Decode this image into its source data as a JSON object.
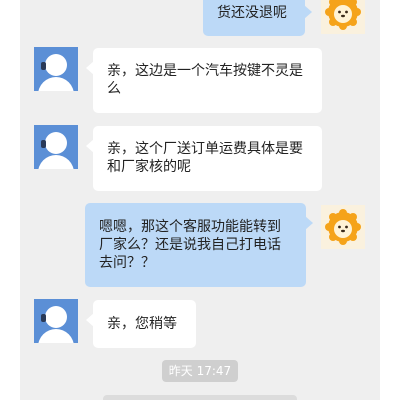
{
  "conversation": {
    "messages": [
      {
        "from": "user",
        "text": "货还没退呢"
      },
      {
        "from": "agent",
        "text": "亲，这边是一个汽车按键不灵是么"
      },
      {
        "from": "agent",
        "text": "亲，这个厂送订单运费具体是要和厂家核的呢"
      },
      {
        "from": "user",
        "text": "嗯嗯，那这个客服功能能转到厂家么？还是说我自己打电话去问？？"
      },
      {
        "from": "agent",
        "text": "亲，您稍等"
      }
    ],
    "timestamp": "昨天 17:47"
  },
  "colors": {
    "page_background": "#ffffff",
    "chat_background": "#efefef",
    "incoming_bubble": "#ffffff",
    "outgoing_bubble": "#bcd9f7",
    "agent_avatar": "#5b8fd6",
    "user_avatar_mascot": "#f5a31a",
    "timestamp_pill": "#cfcfcf"
  },
  "icons": {
    "agent_avatar": "customer-service-headset-icon",
    "user_avatar": "orange-lion-mascot-icon"
  }
}
